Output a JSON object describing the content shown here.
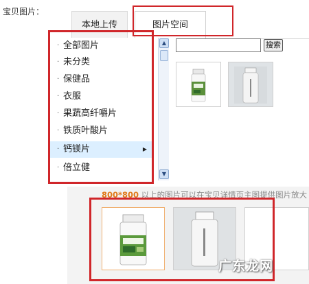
{
  "field_label": "宝贝图片：",
  "tabs": [
    {
      "label": "本地上传",
      "active": false
    },
    {
      "label": "图片空间",
      "active": true
    }
  ],
  "categories": [
    {
      "label": "全部图片"
    },
    {
      "label": "未分类"
    },
    {
      "label": "保健品"
    },
    {
      "label": "衣服"
    },
    {
      "label": "果蔬高纤嚼片"
    },
    {
      "label": "铁质叶酸片"
    },
    {
      "label": "钙镁片",
      "selected": true
    },
    {
      "label": "倍立健"
    }
  ],
  "search": {
    "value": "",
    "button_label": "搜索"
  },
  "size_hint": {
    "size": "800*800",
    "text": "以上的图片可以在宝贝详情页主图提供图片放大"
  },
  "watermark": "广东龙网",
  "colors": {
    "highlight": "#d0262a",
    "selected_row": "#dcefff",
    "size_emphasis": "#e07a1a"
  },
  "icons": {
    "scroll_up": "arrow-up",
    "scroll_down": "arrow-down",
    "submenu": "arrow-right",
    "bullet": "dot"
  }
}
